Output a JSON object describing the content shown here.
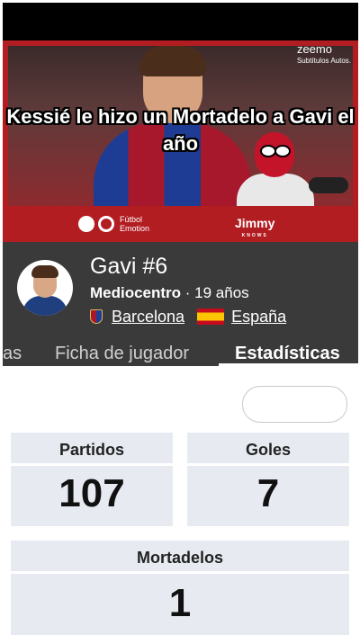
{
  "video": {
    "watermark_brand": "zeemo",
    "watermark_sub": "Subtítulos Autos.",
    "caption": "Kessié le hizo un Mortadelo a Gavi el año",
    "channel_logo_text": [
      "Fútbol",
      "Emotion"
    ],
    "creator_logo": "Jimmy",
    "creator_logo_sub": "KNOWS",
    "colors": {
      "frame": "#b21d22"
    }
  },
  "player": {
    "name": "Gavi #6",
    "position": "Mediocentro",
    "separator": " · ",
    "age": "19 años",
    "club": "Barcelona",
    "country": "España"
  },
  "tabs": [
    {
      "label": "as",
      "active": false
    },
    {
      "label": "Ficha de jugador",
      "active": false
    },
    {
      "label": "Estadísticas",
      "active": true
    }
  ],
  "stats": [
    {
      "label": "Partidos",
      "value": "107"
    },
    {
      "label": "Goles",
      "value": "7"
    },
    {
      "label": "Mortadelos",
      "value": "1"
    }
  ]
}
